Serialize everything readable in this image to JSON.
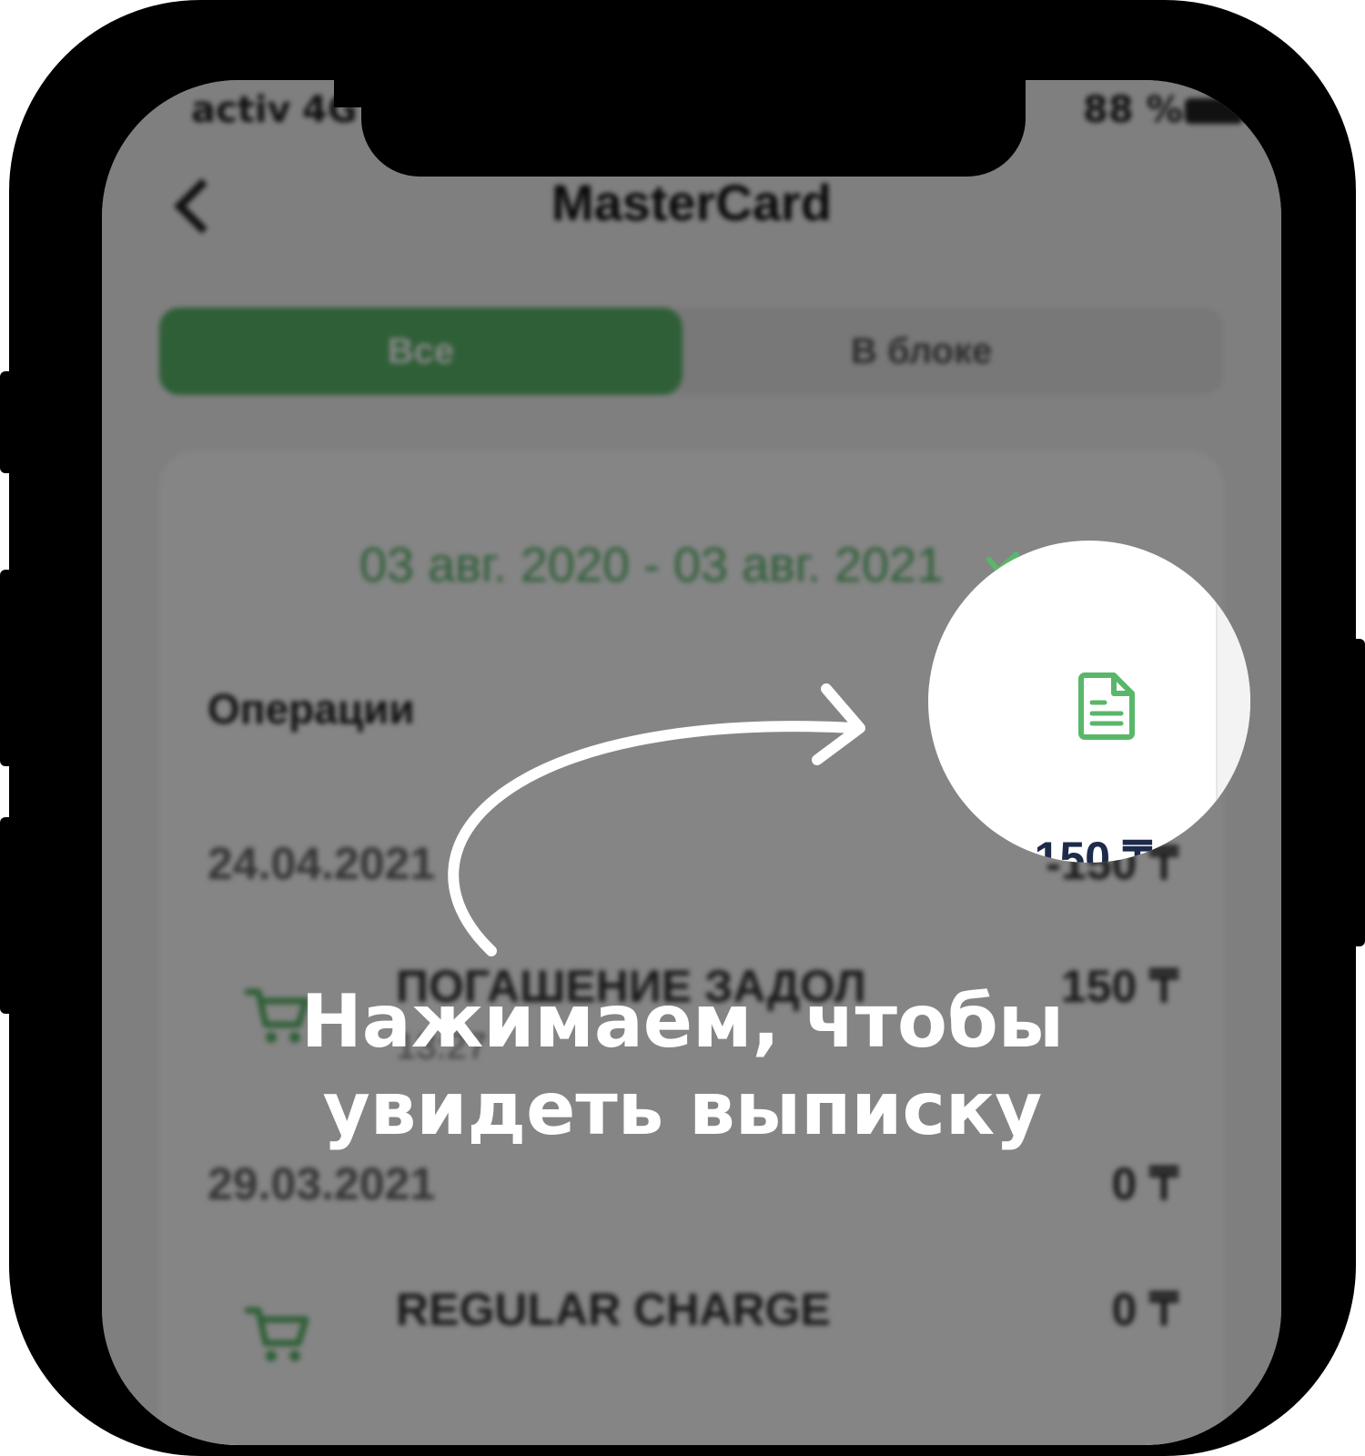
{
  "status_bar": {
    "carrier": "activ",
    "network": "4G",
    "battery": "88 %"
  },
  "nav": {
    "title": "MasterCard",
    "back_icon": "chevron-left-icon"
  },
  "segments": {
    "active": "Все",
    "inactive": "В блоке"
  },
  "filter": {
    "date_range": "03 авг. 2020 - 03 авг. 2021"
  },
  "operations": {
    "title": "Операции",
    "groups": [
      {
        "date": "24.04.2021",
        "total": "-150 ₸",
        "item": {
          "title": "ПОГАШЕНИЕ ЗАДОЛ",
          "sub": "13:27",
          "amount": "150 ₸"
        }
      },
      {
        "date": "29.03.2021",
        "total": "0 ₸",
        "item": {
          "title": "REGULAR CHARGE",
          "sub": "",
          "amount": "0 ₸"
        }
      }
    ]
  },
  "magnifier": {
    "icon": "document-icon",
    "peek_amount": "-150 ₸"
  },
  "colors": {
    "accent_green": "#5ab76a",
    "overlay": "#000000"
  },
  "caption": {
    "line1": "Нажимаем, чтобы",
    "line2": "увидеть выписку"
  }
}
